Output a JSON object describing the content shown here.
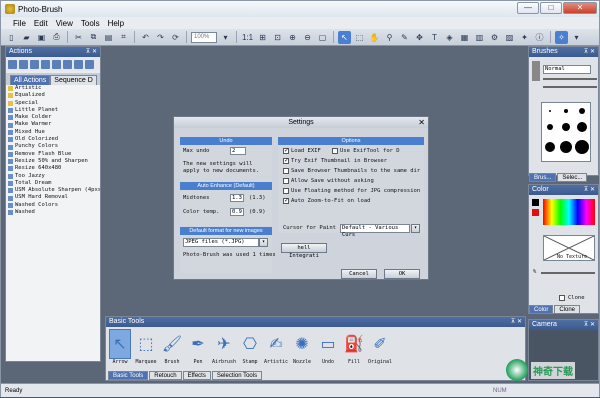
{
  "window": {
    "title": "Photo-Brush",
    "min": "—",
    "max": "□",
    "close": "✕"
  },
  "menu": [
    "File",
    "Edit",
    "View",
    "Tools",
    "Help"
  ],
  "toolbar": {
    "zoom_placeholder": "100%",
    "ratio": "1:1"
  },
  "actions_panel": {
    "title": "Actions",
    "tabs": [
      "All Actions",
      "Sequence D"
    ],
    "items": [
      {
        "label": "Artistic",
        "folder": true
      },
      {
        "label": "Equalized",
        "folder": true
      },
      {
        "label": "Special",
        "folder": true
      },
      {
        "label": "Little Planet",
        "folder": false
      },
      {
        "label": "Make Colder",
        "folder": false
      },
      {
        "label": "Make Warmer",
        "folder": false
      },
      {
        "label": "Mixed Hue",
        "folder": false
      },
      {
        "label": "Old Colorized",
        "folder": false
      },
      {
        "label": "Punchy Colors",
        "folder": false
      },
      {
        "label": "Remove Flash Blue",
        "folder": false
      },
      {
        "label": "Resize 50% and Sharpen",
        "folder": false
      },
      {
        "label": "Resize 640x480",
        "folder": false
      },
      {
        "label": "Too Jazzy",
        "folder": false
      },
      {
        "label": "Total Dream",
        "folder": false
      },
      {
        "label": "USM Absolute Sharpen (4pxs)",
        "folder": false
      },
      {
        "label": "USM Hard Removal",
        "folder": false
      },
      {
        "label": "Washed Colors",
        "folder": false
      },
      {
        "label": "Washed",
        "folder": false
      }
    ]
  },
  "settings": {
    "title": "Settings",
    "undo": {
      "header": "Undo",
      "max_label": "Max undo",
      "max_value": "2",
      "note1": "The new settings will",
      "note2": "apply to  new documents."
    },
    "auto": {
      "header": "Auto Enhance (Default)",
      "midtones_label": "Midtones",
      "midtones_value": "1.3",
      "midtones_default": "(1.3)",
      "colortemp_label": "Color temp.",
      "colortemp_value": "0.9",
      "colortemp_default": "(0.9)"
    },
    "format": {
      "header": "Default format for new images",
      "value": "JPEG files (*.JPG)",
      "usage": "Photo-Brush was used 1 times"
    },
    "options": {
      "header": "Options",
      "items": [
        {
          "label": "Load EXIF",
          "checked": true
        },
        {
          "label": "Use ExifTool for D",
          "checked": false
        },
        {
          "label": "Try Exif Thumbnail in Browser",
          "checked": true
        },
        {
          "label": "Save Browser Thumbnails to the same dir",
          "checked": false
        },
        {
          "label": "Allow Save without asking",
          "checked": false
        },
        {
          "label": "Use Floating method for JPG compression",
          "checked": false
        },
        {
          "label": "Auto Zoom-to-Fit on load",
          "checked": true
        }
      ],
      "cursor_label": "Cursor for Paint",
      "cursor_value": "Default - Various Curs",
      "shell_button": "hell Integrati"
    },
    "cancel": "Cancel",
    "ok": "OK"
  },
  "brushes_panel": {
    "title": "Brushes",
    "mode": "Normal",
    "tabs": [
      "Brus...",
      "Selec..."
    ]
  },
  "color_panel": {
    "title": "Color",
    "no_texture": "No Texture",
    "zoom_label": "%",
    "checkbox": "Clone",
    "tabs": [
      "Color",
      "Clone"
    ]
  },
  "camera_panel": {
    "title": "Camera"
  },
  "basic_tools": {
    "title": "Basic Tools",
    "tools": [
      "Arrow",
      "Marquee",
      "Brush",
      "Pen",
      "Airbrush",
      "Stamp",
      "Artistic",
      "Nozzle",
      "Undo",
      "Fill",
      "Original"
    ],
    "tabs": [
      "Basic Tools",
      "Retouch",
      "Effects",
      "Selection Tools"
    ]
  },
  "status": {
    "left": "Ready",
    "num": "NUM"
  },
  "watermark": {
    "text": "神奇下载"
  },
  "colors": {
    "accent": "#4a7fcf",
    "panel_header": "#3b5a90",
    "workspace": "#5c6777"
  }
}
